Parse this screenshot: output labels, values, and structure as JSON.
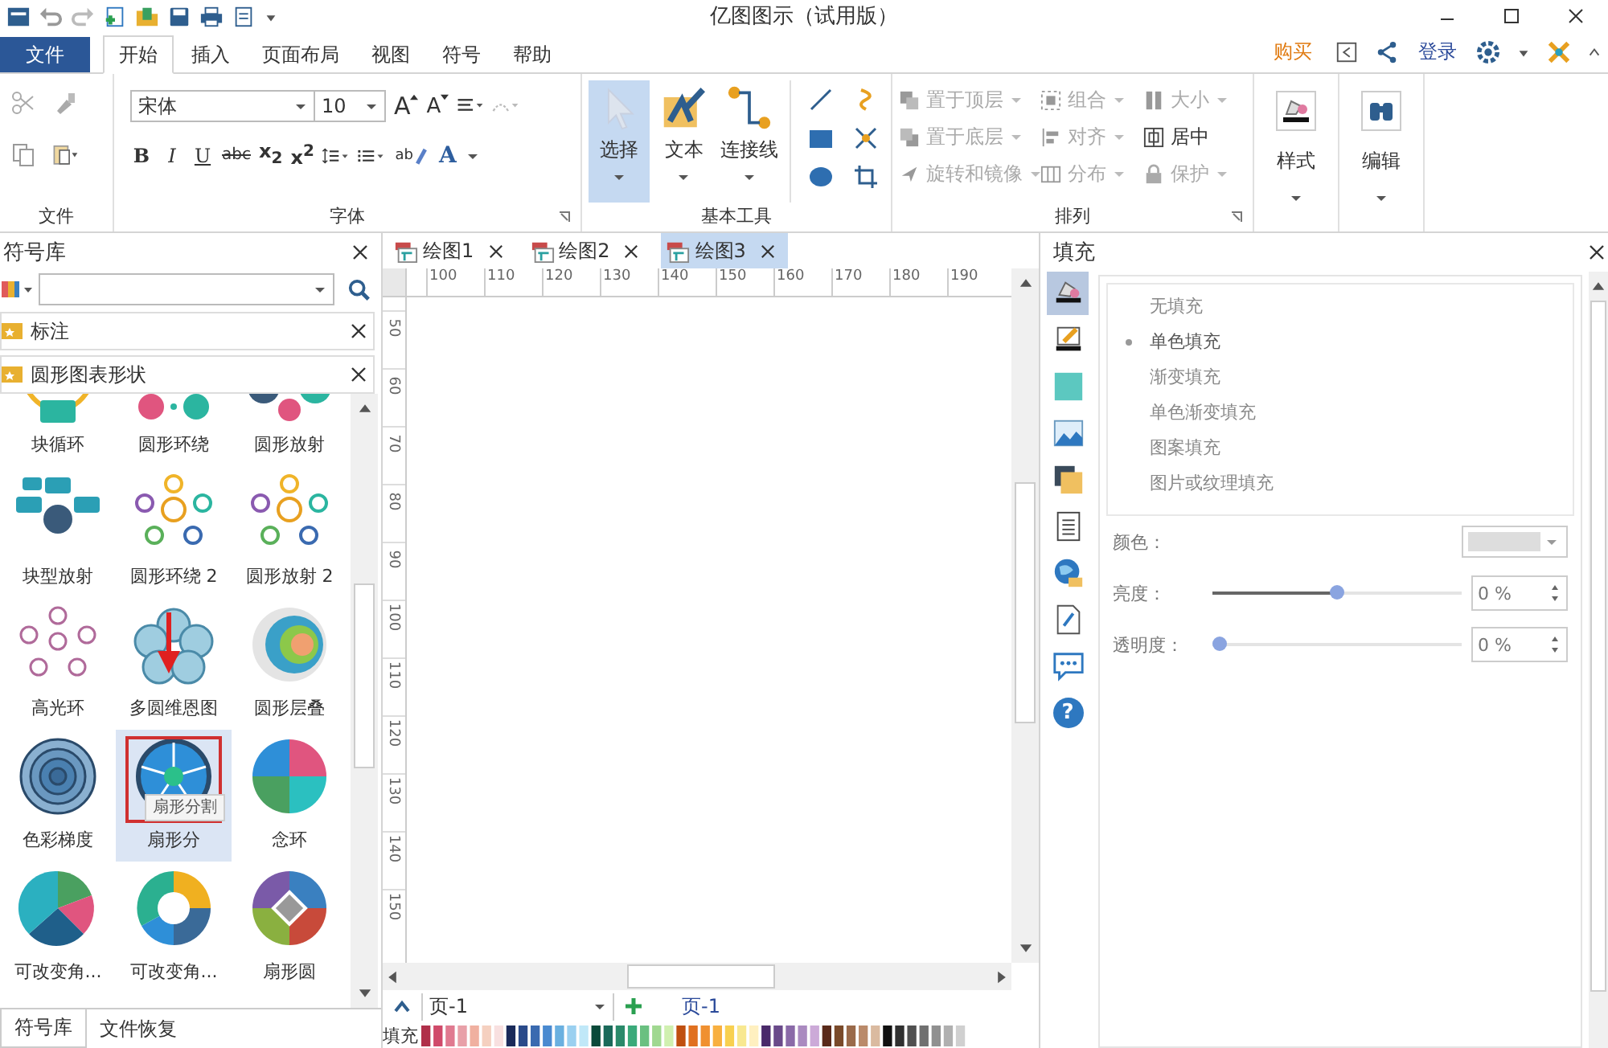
{
  "window": {
    "title": "亿图图示（试用版）"
  },
  "top_right": {
    "buy": "购买",
    "login": "登录"
  },
  "file_button": "文件",
  "menu_tabs": [
    {
      "label": "开始",
      "selected": true
    },
    {
      "label": "插入",
      "selected": false
    },
    {
      "label": "页面布局",
      "selected": false
    },
    {
      "label": "视图",
      "selected": false
    },
    {
      "label": "符号",
      "selected": false
    },
    {
      "label": "帮助",
      "selected": false
    }
  ],
  "ribbon": {
    "clipboard": {
      "label": "文件"
    },
    "font": {
      "label": "字体",
      "family": "宋体",
      "size": "10",
      "size_buttons": [
        "A",
        "A"
      ],
      "format_buttons": [
        "B",
        "I",
        "U",
        "abc",
        "x$_{2}$",
        "x$^{2}$"
      ],
      "highlight": "ab",
      "font_color": "A"
    },
    "tools": {
      "label": "基本工具",
      "buttons": [
        {
          "label": "选择",
          "selected": true
        },
        {
          "label": "文本",
          "selected": false
        },
        {
          "label": "连接线",
          "selected": false
        }
      ]
    },
    "arrange": {
      "label": "排列",
      "items": [
        {
          "label": "置于顶层",
          "disabled": true
        },
        {
          "label": "组合",
          "disabled": true
        },
        {
          "label": "大小",
          "disabled": true
        },
        {
          "label": "置于底层",
          "disabled": true
        },
        {
          "label": "对齐",
          "disabled": true
        },
        {
          "label": "居中",
          "disabled": false
        },
        {
          "label": "旋转和镜像",
          "disabled": true
        },
        {
          "label": "分布",
          "disabled": true
        },
        {
          "label": "保护",
          "disabled": true
        }
      ]
    },
    "style": {
      "label": "样式"
    },
    "edit": {
      "label": "编辑"
    }
  },
  "library": {
    "title": "符号库",
    "sections": [
      {
        "label": "标注"
      },
      {
        "label": "圆形图表形状"
      }
    ],
    "shapes": [
      {
        "label": "块循环",
        "selected": false
      },
      {
        "label": "圆形环绕",
        "selected": false
      },
      {
        "label": "圆形放射",
        "selected": false
      },
      {
        "label": "块型放射",
        "selected": false
      },
      {
        "label": "圆形环绕 2",
        "selected": false
      },
      {
        "label": "圆形放射 2",
        "selected": false
      },
      {
        "label": "高光环",
        "selected": false
      },
      {
        "label": "多圆维恩图",
        "selected": false
      },
      {
        "label": "圆形层叠",
        "selected": false
      },
      {
        "label": "色彩梯度",
        "selected": false
      },
      {
        "label": "扇形分",
        "selected": true
      },
      {
        "label": "念环",
        "selected": false
      },
      {
        "label": "可改变角...",
        "selected": false
      },
      {
        "label": "可改变角...",
        "selected": false
      },
      {
        "label": "扇形圆",
        "selected": false
      }
    ],
    "tooltip": "扇形分割",
    "bottom_tabs": [
      {
        "label": "符号库",
        "selected": true
      },
      {
        "label": "文件恢复",
        "selected": false
      }
    ]
  },
  "doc_tabs": [
    {
      "label": "绘图1",
      "selected": false
    },
    {
      "label": "绘图2",
      "selected": false
    },
    {
      "label": "绘图3",
      "selected": true
    }
  ],
  "ruler": {
    "h_ticks": [
      "100",
      "110",
      "120",
      "130",
      "140",
      "150",
      "160",
      "170",
      "180",
      "190"
    ],
    "v_ticks": [
      "50",
      "60",
      "70",
      "80",
      "90",
      "100",
      "110",
      "120",
      "130",
      "140",
      "150"
    ]
  },
  "page_bar": {
    "page_select": "页-1",
    "page_tab": "页-1"
  },
  "palette": {
    "label": "填充"
  },
  "fill_panel": {
    "title": "填充",
    "side_tools": [
      {
        "selected": true
      },
      {
        "selected": false
      },
      {
        "selected": false
      },
      {
        "selected": false
      },
      {
        "selected": false
      },
      {
        "selected": false
      },
      {
        "selected": false
      },
      {
        "selected": false
      },
      {
        "selected": false
      }
    ],
    "help_button": "?",
    "options": [
      {
        "label": "无填充",
        "selected": false
      },
      {
        "label": "单色填充",
        "selected": true
      },
      {
        "label": "渐变填充",
        "selected": false
      },
      {
        "label": "单色渐变填充",
        "selected": false
      },
      {
        "label": "图案填充",
        "selected": false
      },
      {
        "label": "图片或纹理填充",
        "selected": false
      }
    ],
    "color_label": "颜色：",
    "sliders": [
      {
        "label": "亮度：",
        "level": 0.5,
        "value": "0 %"
      },
      {
        "label": "透明度：",
        "level": 0,
        "value": "0 %"
      }
    ]
  }
}
